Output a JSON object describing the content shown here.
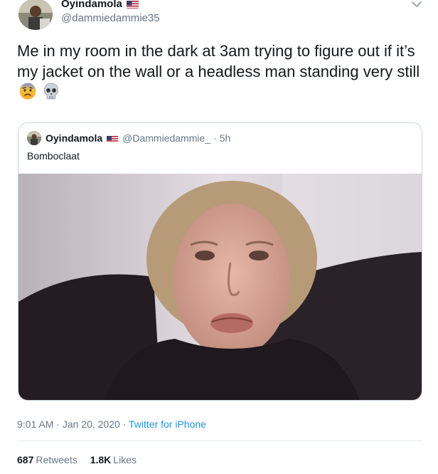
{
  "tweet": {
    "author": {
      "display_name": "Oyindamola",
      "handle": "@dammiedammie35",
      "flag_icon": "us-flag-icon",
      "avatar_icon": "profile-avatar"
    },
    "menu_icon": "chevron-down-icon",
    "text": "Me in my room in the dark at 3am trying to figure out if it’s my jacket on the wall or a headless man standing very still",
    "emojis": [
      "anxious-face-with-sweat-emoji",
      "skull-emoji"
    ],
    "quoted": {
      "display_name": "Oyindamola",
      "handle": "@Dammiedammie_",
      "separator": "·",
      "age": "5h",
      "text": "Bomboclaat"
    },
    "meta": {
      "time": "9:01 AM",
      "date": "Jan 20, 2020",
      "source": "Twitter for iPhone"
    },
    "stats": {
      "retweets_count": "687",
      "retweets_label": "Retweets",
      "likes_count": "1.8K",
      "likes_label": "Likes"
    }
  },
  "colors": {
    "text_primary": "#14171a",
    "text_secondary": "#657786",
    "link": "#1b95e0",
    "border": "#ccd6dd"
  }
}
